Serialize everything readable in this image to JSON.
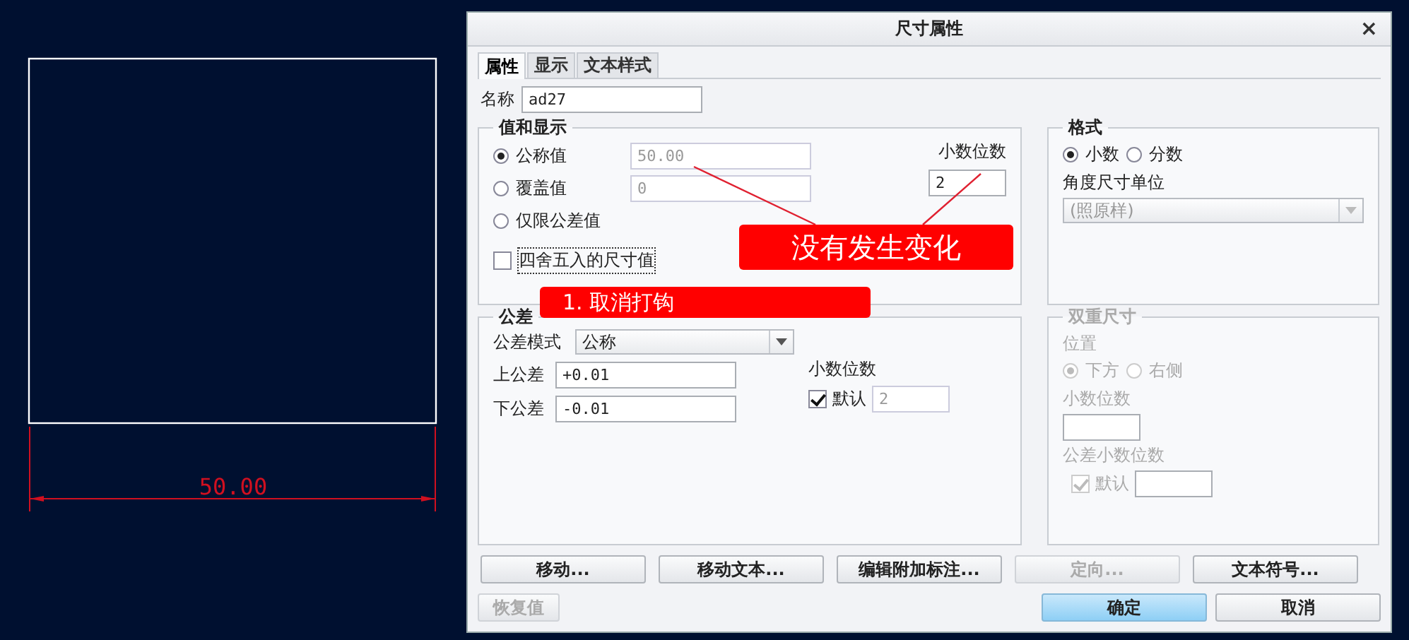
{
  "canvas": {
    "dimension": "50.00"
  },
  "dialog": {
    "title": "尺寸属性",
    "close": "×",
    "tabs": [
      {
        "label": "属性",
        "selected": true
      },
      {
        "label": "显示",
        "selected": false
      },
      {
        "label": "文本样式",
        "selected": false
      }
    ],
    "name": {
      "label": "名称",
      "value": "ad27"
    },
    "value_display": {
      "title": "值和显示",
      "options": [
        {
          "label": "公称值",
          "selected": true,
          "value": "50.00"
        },
        {
          "label": "覆盖值",
          "selected": false,
          "value": "0"
        },
        {
          "label": "仅限公差值",
          "selected": false
        }
      ],
      "decimals_label": "小数位数",
      "decimals": "2",
      "rounded": {
        "label": "四舍五入的尺寸值",
        "checked": false
      }
    },
    "format": {
      "title": "格式",
      "options": [
        {
          "label": "小数",
          "selected": true
        },
        {
          "label": "分数",
          "selected": false
        }
      ],
      "angle_label": "角度尺寸单位",
      "angle_value": "(照原样)",
      "angle_disabled": true
    },
    "tolerance": {
      "title": "公差",
      "mode_label": "公差模式",
      "mode": "公称",
      "upper_label": "上公差",
      "upper": "+0.01",
      "lower_label": "下公差",
      "lower": "-0.01",
      "decimals_label": "小数位数",
      "default": {
        "label": "默认",
        "checked": true
      },
      "decimals": "2"
    },
    "dual": {
      "title": "双重尺寸",
      "disabled": true,
      "position_label": "位置",
      "positions": [
        {
          "label": "下方",
          "selected": true
        },
        {
          "label": "右侧",
          "selected": false
        }
      ],
      "decimals_label": "小数位数",
      "tol_decimals_label": "公差小数位数",
      "default": {
        "label": "默认",
        "checked": true
      }
    },
    "buttons": [
      {
        "label": "移动...",
        "disabled": false
      },
      {
        "label": "移动文本...",
        "disabled": false
      },
      {
        "label": "编辑附加标注...",
        "disabled": false
      },
      {
        "label": "定向...",
        "disabled": true
      },
      {
        "label": "文本符号...",
        "disabled": false
      }
    ],
    "restore": {
      "label": "恢复值",
      "disabled": true
    },
    "ok": {
      "label": "确定"
    },
    "cancel": {
      "label": "取消"
    }
  },
  "annotations": [
    {
      "text": "没有发生变化"
    },
    {
      "text": "1. 取消打钩"
    }
  ]
}
